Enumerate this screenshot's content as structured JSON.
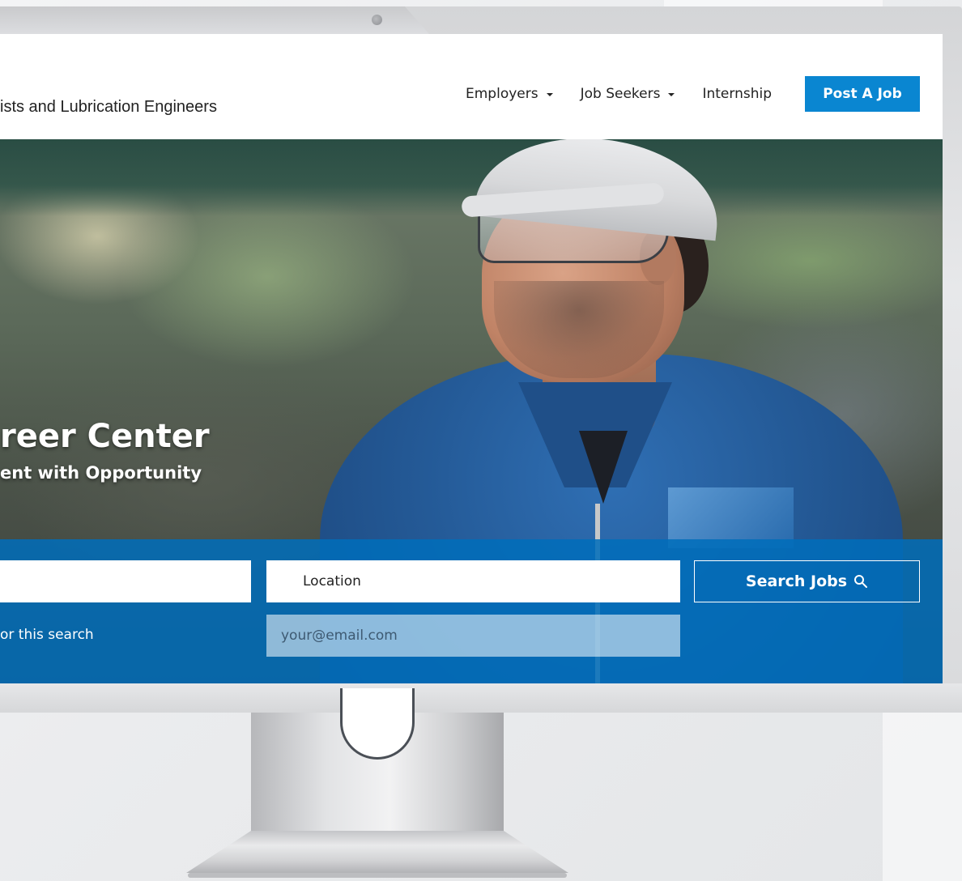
{
  "site": {
    "org_name": "ists and Lubrication Engineers"
  },
  "nav": {
    "items": [
      {
        "label": "Employers",
        "has_dropdown": true
      },
      {
        "label": "Job Seekers",
        "has_dropdown": true
      },
      {
        "label": "Internship",
        "has_dropdown": false
      }
    ],
    "post_job_label": "Post A Job"
  },
  "hero": {
    "title": "reer Center",
    "subtitle": "ent with Opportunity"
  },
  "search": {
    "keyword_value": "",
    "location_placeholder": "Location",
    "button_label": "Search Jobs",
    "alert_text": "or this search",
    "email_placeholder": "your@email.com"
  },
  "colors": {
    "accent": "#0a86d1",
    "search_band": "#006dba",
    "nav_text": "#222222"
  },
  "icons": {
    "search": "search-icon",
    "dropdown": "chevron-down-icon",
    "camera": "camera-icon"
  }
}
